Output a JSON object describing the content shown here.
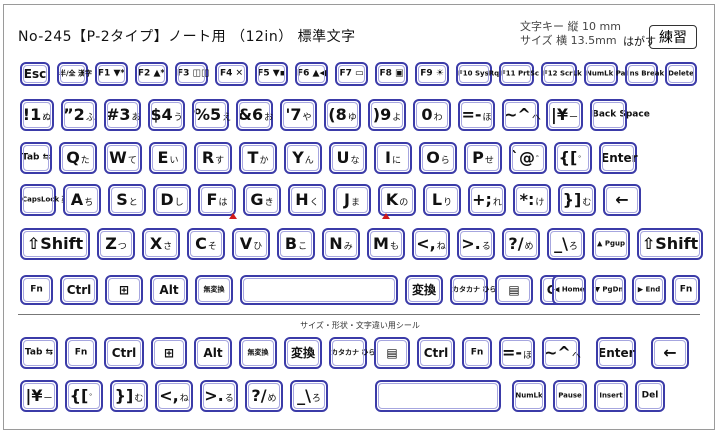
{
  "header": {
    "title": "No-245【P-2タイプ】ノート用 （12in） 標準文字",
    "size_line1": "文字キー 縦 10 mm",
    "size_line2": "サイズ 横 13.5mm",
    "peel_label": "はがす",
    "practice_label": "練習"
  },
  "spare_caption": "サイズ・形状・文字違い用シール",
  "rows_main": [
    {
      "name": "function-row",
      "keys": [
        {
          "id": "esc",
          "label": "Esc",
          "size": "med"
        },
        {
          "id": "hankaku-zenkaku",
          "label": "半/全 漢字",
          "size": "xs"
        },
        {
          "id": "f1",
          "label": "F1 ▼*",
          "size": "sm"
        },
        {
          "id": "f2",
          "label": "F2 ▲*",
          "size": "sm"
        },
        {
          "id": "f3",
          "label": "F3 ◫◫",
          "size": "sm"
        },
        {
          "id": "f4",
          "label": "F4 ✕",
          "size": "sm"
        },
        {
          "id": "f5",
          "label": "F5 ▼▪",
          "size": "sm"
        },
        {
          "id": "f6",
          "label": "F6 ▲◀",
          "size": "sm"
        },
        {
          "id": "f7",
          "label": "F7 ▭",
          "size": "sm"
        },
        {
          "id": "f8",
          "label": "F8 ▣",
          "size": "sm"
        },
        {
          "id": "f9",
          "label": "F9 ☀",
          "size": "sm"
        },
        {
          "id": "f10",
          "label": "F10 SysRq",
          "size": "xs"
        },
        {
          "id": "f11",
          "label": "F11 PrtSc",
          "size": "xs"
        },
        {
          "id": "f12",
          "label": "F12 ScrLk",
          "size": "xs"
        },
        {
          "id": "numlock",
          "label": "NumLk Pause",
          "size": "xs"
        },
        {
          "id": "insert",
          "label": "Ins Break",
          "size": "xs"
        },
        {
          "id": "delete",
          "label": "Delete",
          "size": "xs"
        }
      ]
    },
    {
      "name": "number-row",
      "keys": [
        {
          "id": "key-1",
          "label": "!1",
          "kana": "ぬ",
          "size": "big"
        },
        {
          "id": "key-2",
          "label": "”2",
          "kana": "ふ",
          "size": "big"
        },
        {
          "id": "key-3",
          "label": "#3",
          "kana": "あ",
          "size": "big"
        },
        {
          "id": "key-4",
          "label": "$4",
          "kana": "う",
          "size": "big"
        },
        {
          "id": "key-5",
          "label": "%5",
          "kana": "え",
          "size": "big"
        },
        {
          "id": "key-6",
          "label": "&6",
          "kana": "お",
          "size": "big"
        },
        {
          "id": "key-7",
          "label": "'7",
          "kana": "や",
          "size": "big"
        },
        {
          "id": "key-8",
          "label": "(8",
          "kana": "ゆ",
          "size": "big"
        },
        {
          "id": "key-9",
          "label": ")9",
          "kana": "よ",
          "size": "big"
        },
        {
          "id": "key-0",
          "label": "0",
          "kana": "わ",
          "size": "big"
        },
        {
          "id": "key-minus",
          "label": "=-",
          "kana": "ほ",
          "size": "big"
        },
        {
          "id": "key-caret",
          "label": "~^",
          "kana": "へ",
          "size": "big"
        },
        {
          "id": "key-yen",
          "label": "|¥",
          "kana": "ー",
          "size": "big"
        },
        {
          "id": "backspace",
          "label": "Back Space",
          "size": "sm"
        }
      ]
    },
    {
      "name": "qwerty-row",
      "keys": [
        {
          "id": "tab",
          "label": "Tab ⇆",
          "size": "sm"
        },
        {
          "id": "key-q",
          "label": "Q",
          "kana": "た",
          "size": "big"
        },
        {
          "id": "key-w",
          "label": "W",
          "kana": "て",
          "size": "big"
        },
        {
          "id": "key-e",
          "label": "E",
          "kana": "い",
          "size": "big"
        },
        {
          "id": "key-r",
          "label": "R",
          "kana": "す",
          "size": "big"
        },
        {
          "id": "key-t",
          "label": "T",
          "kana": "か",
          "size": "big"
        },
        {
          "id": "key-y",
          "label": "Y",
          "kana": "ん",
          "size": "big"
        },
        {
          "id": "key-u",
          "label": "U",
          "kana": "な",
          "size": "big"
        },
        {
          "id": "key-i",
          "label": "I",
          "kana": "に",
          "size": "big"
        },
        {
          "id": "key-o",
          "label": "O",
          "kana": "ら",
          "size": "big"
        },
        {
          "id": "key-p",
          "label": "P",
          "kana": "せ",
          "size": "big"
        },
        {
          "id": "key-at",
          "label": "`@",
          "kana": "゛",
          "size": "big"
        },
        {
          "id": "key-bracket-open",
          "label": "{[",
          "kana": "゜",
          "size": "big"
        },
        {
          "id": "enter",
          "label": "Enter",
          "size": "med"
        }
      ]
    },
    {
      "name": "home-row",
      "keys": [
        {
          "id": "capslock",
          "label": "CapsLock 英数",
          "size": "xs"
        },
        {
          "id": "key-a",
          "label": "A",
          "kana": "ち",
          "size": "big"
        },
        {
          "id": "key-s",
          "label": "S",
          "kana": "と",
          "size": "big"
        },
        {
          "id": "key-d",
          "label": "D",
          "kana": "し",
          "size": "big"
        },
        {
          "id": "key-f",
          "label": "F",
          "kana": "は",
          "size": "big"
        },
        {
          "id": "key-g",
          "label": "G",
          "kana": "き",
          "size": "big"
        },
        {
          "id": "key-h",
          "label": "H",
          "kana": "く",
          "size": "big"
        },
        {
          "id": "key-j",
          "label": "J",
          "kana": "ま",
          "size": "big"
        },
        {
          "id": "key-k",
          "label": "K",
          "kana": "の",
          "size": "big"
        },
        {
          "id": "key-l",
          "label": "L",
          "kana": "り",
          "size": "big"
        },
        {
          "id": "key-semicolon",
          "label": "+;",
          "kana": "れ",
          "size": "big"
        },
        {
          "id": "key-colon",
          "label": "*:",
          "kana": "け",
          "size": "big"
        },
        {
          "id": "key-bracket-close",
          "label": "}]",
          "kana": "む",
          "size": "big"
        },
        {
          "id": "return-arrow",
          "label": "←",
          "size": "big"
        }
      ]
    },
    {
      "name": "shift-row",
      "keys": [
        {
          "id": "shift-left",
          "label": "⇧Shift",
          "size": "big"
        },
        {
          "id": "key-z",
          "label": "Z",
          "kana": "つ",
          "size": "big"
        },
        {
          "id": "key-x",
          "label": "X",
          "kana": "さ",
          "size": "big"
        },
        {
          "id": "key-c",
          "label": "C",
          "kana": "そ",
          "size": "big"
        },
        {
          "id": "key-v",
          "label": "V",
          "kana": "ひ",
          "size": "big"
        },
        {
          "id": "key-b",
          "label": "B",
          "kana": "こ",
          "size": "big"
        },
        {
          "id": "key-n",
          "label": "N",
          "kana": "み",
          "size": "big"
        },
        {
          "id": "key-m",
          "label": "M",
          "kana": "も",
          "size": "big"
        },
        {
          "id": "key-comma",
          "label": "<,",
          "kana": "ね",
          "size": "big"
        },
        {
          "id": "key-period",
          "label": ">.",
          "kana": "る",
          "size": "big"
        },
        {
          "id": "key-slash",
          "label": "?/",
          "kana": "め",
          "size": "big"
        },
        {
          "id": "key-backslash",
          "label": "_\\",
          "kana": "ろ",
          "size": "big"
        },
        {
          "id": "page-up",
          "label": "▲ Pgup",
          "size": "xs"
        },
        {
          "id": "shift-right",
          "label": "⇧Shift",
          "size": "big"
        }
      ]
    },
    {
      "name": "bottom-row",
      "keys": [
        {
          "id": "fn-left",
          "label": "Fn",
          "size": "sm"
        },
        {
          "id": "ctrl-left",
          "label": "Ctrl",
          "size": "med"
        },
        {
          "id": "windows",
          "label": "⊞",
          "size": "med"
        },
        {
          "id": "alt",
          "label": "Alt",
          "size": "med"
        },
        {
          "id": "muhenkan",
          "label": "無変換",
          "size": "xs"
        },
        {
          "id": "space",
          "label": "",
          "size": "med"
        },
        {
          "id": "henkan",
          "label": "変換",
          "size": "med"
        },
        {
          "id": "katakana-hiragana",
          "label": "カタカナ ひらがな",
          "size": "xs"
        },
        {
          "id": "application",
          "label": "▤",
          "size": "med"
        },
        {
          "id": "ctrl-right",
          "label": "Ctrl",
          "size": "med"
        },
        {
          "id": "home",
          "label": "◀ Home",
          "size": "xs"
        },
        {
          "id": "page-down",
          "label": "▼ PgDn",
          "size": "xs"
        },
        {
          "id": "end",
          "label": "▶ End",
          "size": "xs"
        },
        {
          "id": "fn-right",
          "label": "Fn",
          "size": "sm"
        }
      ]
    }
  ],
  "rows_spare": [
    {
      "name": "spare-row-1",
      "keys": [
        {
          "id": "spare-tab",
          "label": "Tab ⇆",
          "size": "sm"
        },
        {
          "id": "spare-fn",
          "label": "Fn",
          "size": "sm"
        },
        {
          "id": "spare-ctrl",
          "label": "Ctrl",
          "size": "med"
        },
        {
          "id": "spare-windows",
          "label": "⊞",
          "size": "med"
        },
        {
          "id": "spare-alt",
          "label": "Alt",
          "size": "med"
        },
        {
          "id": "spare-muhenkan",
          "label": "無変換",
          "size": "xs"
        },
        {
          "id": "spare-henkan",
          "label": "変換",
          "size": "med"
        },
        {
          "id": "spare-katakana",
          "label": "カタカナ ひらがな",
          "size": "xs"
        },
        {
          "id": "spare-application",
          "label": "▤",
          "size": "med"
        },
        {
          "id": "spare-ctrl-2",
          "label": "Ctrl",
          "size": "med"
        },
        {
          "id": "spare-fn-2",
          "label": "Fn",
          "size": "sm"
        },
        {
          "id": "spare-minus",
          "label": "=-",
          "kana": "ほ",
          "size": "big"
        },
        {
          "id": "spare-caret",
          "label": "~^",
          "kana": "へ",
          "size": "big"
        },
        {
          "id": "spare-enter",
          "label": "Enter",
          "size": "med"
        },
        {
          "id": "spare-return-arrow",
          "label": "←",
          "size": "big"
        }
      ]
    },
    {
      "name": "spare-row-2",
      "keys": [
        {
          "id": "spare-yen",
          "label": "|¥",
          "kana": "ー",
          "size": "big"
        },
        {
          "id": "spare-bracket-open",
          "label": "{[",
          "kana": "゜",
          "size": "big"
        },
        {
          "id": "spare-bracket-close",
          "label": "}]",
          "kana": "む",
          "size": "big"
        },
        {
          "id": "spare-comma",
          "label": "<,",
          "kana": "ね",
          "size": "big"
        },
        {
          "id": "spare-period",
          "label": ">.",
          "kana": "る",
          "size": "big"
        },
        {
          "id": "spare-slash",
          "label": "?/",
          "kana": "め",
          "size": "big"
        },
        {
          "id": "spare-backslash",
          "label": "_\\",
          "kana": "ろ",
          "size": "big"
        },
        {
          "id": "spare-space",
          "label": "",
          "size": "med"
        },
        {
          "id": "spare-numlock",
          "label": "NumLk",
          "size": "xs"
        },
        {
          "id": "spare-pause",
          "label": "Pause",
          "size": "xs"
        },
        {
          "id": "spare-insert",
          "label": "Insert",
          "size": "xs"
        },
        {
          "id": "spare-delete",
          "label": "Del",
          "size": "sm"
        }
      ]
    }
  ]
}
